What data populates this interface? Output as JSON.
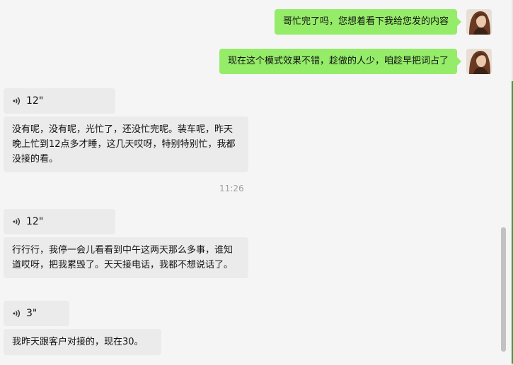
{
  "messages": {
    "sent": [
      {
        "text": "哥忙完了吗，您想着看下我给您发的内容",
        "avatar": "user-avatar"
      },
      {
        "text": "现在这个模式效果不错，趁做的人少，咱趁早把词占了",
        "avatar": "user-avatar"
      }
    ],
    "received": [
      {
        "type": "voice",
        "duration": "12\""
      },
      {
        "type": "text",
        "text": "没有呢，没有呢，光忙了，还没忙完呢。装车呢，昨天晚上忙到12点多才睡，这几天哎呀，特别特别忙，我都没接的看。"
      },
      {
        "type": "voice",
        "duration": "12\""
      },
      {
        "type": "text",
        "text": "行行行，我停一会儿看看到中午这两天那么多事，谁知道哎呀，把我累毁了。天天接电话，我都不想说话了。"
      },
      {
        "type": "voice",
        "duration": "3\""
      },
      {
        "type": "text",
        "text": "我昨天跟客户对接的，现在30。"
      }
    ],
    "timestamp": "11:26"
  },
  "colors": {
    "sent_bubble": "#95ec69",
    "received_bubble": "#ebebeb",
    "background": "#f5f5f5"
  }
}
